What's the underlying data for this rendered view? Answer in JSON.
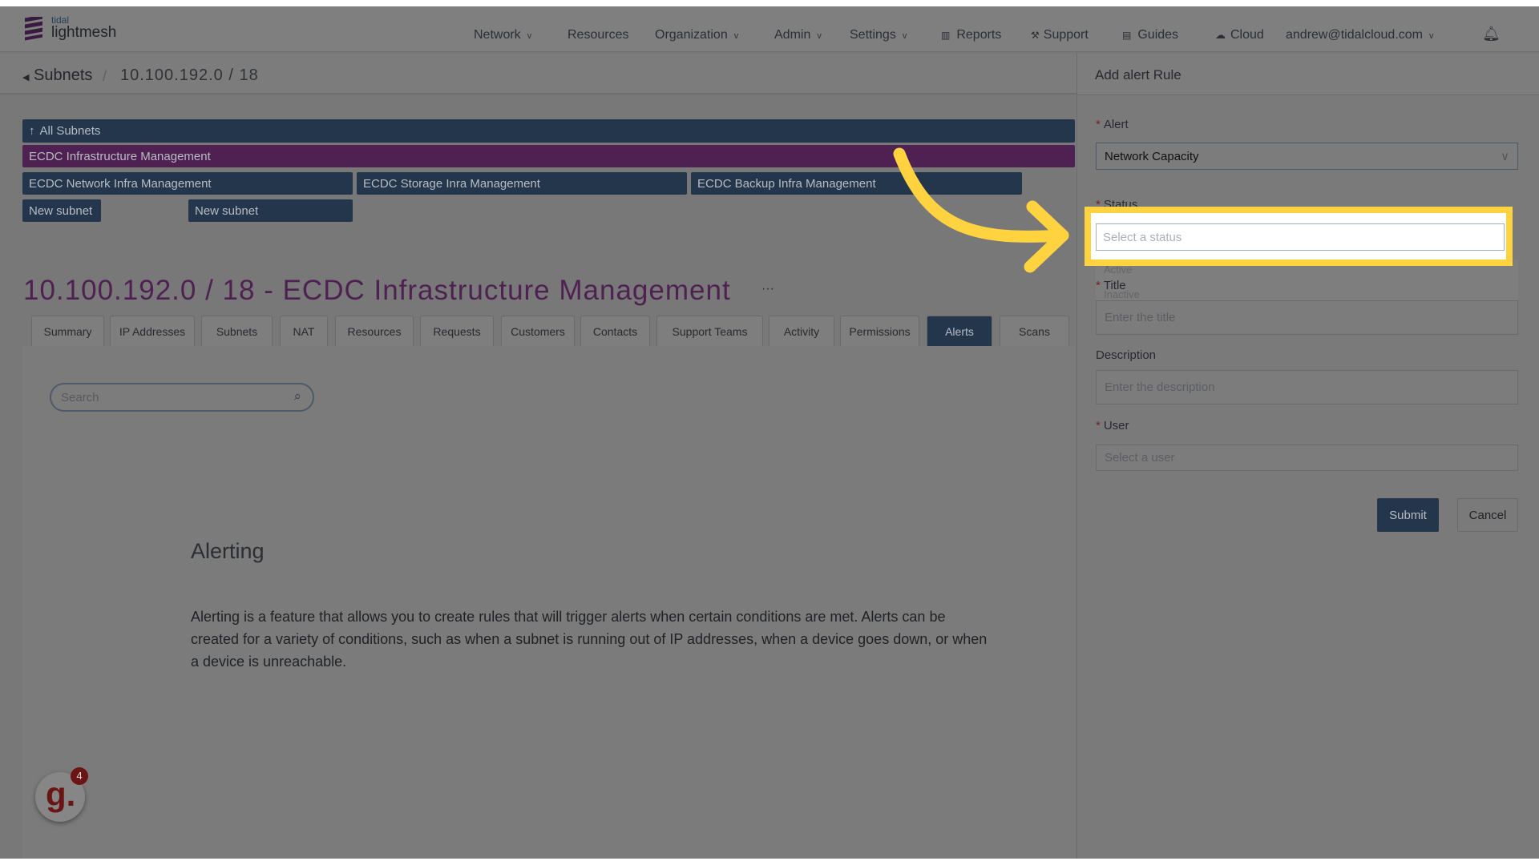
{
  "brand": {
    "small": "tidal",
    "name": "lightmesh"
  },
  "nav": [
    {
      "label": "Network",
      "dropdown": true
    },
    {
      "label": "Resources"
    },
    {
      "label": "Organization",
      "dropdown": true
    },
    {
      "label": "Admin",
      "dropdown": true
    },
    {
      "label": "Settings",
      "dropdown": true
    },
    {
      "label": "Reports",
      "icon": "bar-chart-icon"
    },
    {
      "label": "Support",
      "icon": "wrench-icon"
    },
    {
      "label": "Guides",
      "icon": "book-icon"
    },
    {
      "label": "Cloud",
      "icon": "cloud-icon"
    },
    {
      "label": "andrew@tidalcloud.com",
      "dropdown": true
    }
  ],
  "breadcrumb": {
    "back": "Subnets",
    "sep": "/",
    "current": "10.100.192.0 / 18"
  },
  "tree": {
    "root": "All Subnets",
    "parent": "ECDC Infrastructure Management",
    "children": [
      "ECDC Network Infra Management",
      "ECDC Storage Inra Management",
      "ECDC Backup Infra Management"
    ],
    "new": [
      "New subnet",
      "New subnet"
    ]
  },
  "page_title": "10.100.192.0 / 18 - ECDC Infrastructure Management",
  "more": "···",
  "tabs": [
    "Summary",
    "IP Addresses",
    "Subnets",
    "NAT",
    "Resources",
    "Requests",
    "Customers",
    "Contacts",
    "Support Teams",
    "Activity",
    "Permissions",
    "Alerts",
    "Scans"
  ],
  "active_tab": "Alerts",
  "search": {
    "placeholder": "Search"
  },
  "alerting": {
    "heading": "Alerting",
    "body": "Alerting is a feature that allows you to create rules that will trigger alerts when certain conditions are met. Alerts can be created for a variety of conditions, such as when a subnet is running out of IP addresses, when a device goes down, or when a device is unreachable."
  },
  "badge": {
    "letter": "g.",
    "count": "4"
  },
  "form": {
    "title": "Add alert Rule",
    "alert_label": "Alert",
    "alert_value": "Network Capacity",
    "status_label": "Status",
    "status_placeholder": "Select a status",
    "status_options": [
      "Active",
      "Inactive"
    ],
    "title_label": "Title",
    "title_placeholder": "Enter the title",
    "desc_label": "Description",
    "desc_placeholder": "Enter the description",
    "user_label": "User",
    "user_placeholder": "Select a user",
    "submit": "Submit",
    "cancel": "Cancel"
  },
  "colors": {
    "highlight": "#ffd23f",
    "navy": "#24364b",
    "purple": "#4f2152"
  }
}
